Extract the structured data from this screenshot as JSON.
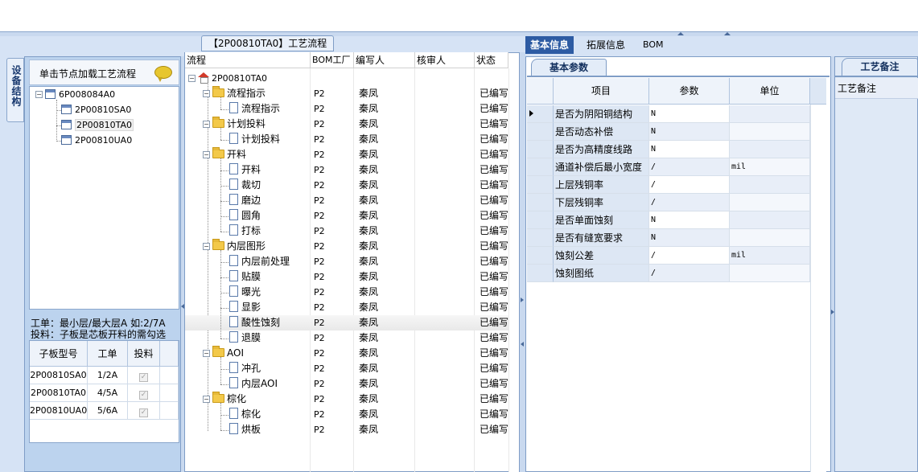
{
  "left": {
    "vertical_tab": "设备结构",
    "header_text": "单击节点加载工艺流程",
    "tree": [
      {
        "label": "6P008084A0",
        "level": 0
      },
      {
        "label": "2P00810SA0",
        "level": 1
      },
      {
        "label": "2P00810TA0",
        "level": 1,
        "selected": true
      },
      {
        "label": "2P00810UA0",
        "level": 1
      }
    ],
    "hint_line1": "工单：最小层/最大层A 如:2/7A",
    "hint_line2": "投料：子板是芯板开料的需勾选",
    "sub_grid": {
      "headers": [
        "子板型号",
        "工单",
        "投料"
      ],
      "rows": [
        {
          "model": "2P00810SA0",
          "order": "1/2A",
          "feed": true
        },
        {
          "model": "2P00810TA0",
          "order": "4/5A",
          "feed": true
        },
        {
          "model": "2P00810UA0",
          "order": "5/6A",
          "feed": true
        }
      ]
    }
  },
  "middle": {
    "title": "【2P00810TA0】工艺流程",
    "headers": [
      "流程",
      "BOM工厂",
      "编写人",
      "核审人",
      "状态"
    ],
    "root": "2P00810TA0",
    "rows": [
      {
        "name": "流程指示",
        "type": "folder",
        "bom": "P2",
        "author": "秦凤",
        "status": "已编写"
      },
      {
        "name": "流程指示",
        "type": "doc",
        "bom": "P2",
        "author": "秦凤",
        "status": "已编写"
      },
      {
        "name": "计划投料",
        "type": "folder",
        "bom": "P2",
        "author": "秦凤",
        "status": "已编写"
      },
      {
        "name": "计划投料",
        "type": "doc",
        "bom": "P2",
        "author": "秦凤",
        "status": "已编写"
      },
      {
        "name": "开料",
        "type": "folder",
        "bom": "P2",
        "author": "秦凤",
        "status": "已编写"
      },
      {
        "name": "开料",
        "type": "doc",
        "bom": "P2",
        "author": "秦凤",
        "status": "已编写"
      },
      {
        "name": "裁切",
        "type": "doc",
        "bom": "P2",
        "author": "秦凤",
        "status": "已编写"
      },
      {
        "name": "磨边",
        "type": "doc",
        "bom": "P2",
        "author": "秦凤",
        "status": "已编写"
      },
      {
        "name": "圆角",
        "type": "doc",
        "bom": "P2",
        "author": "秦凤",
        "status": "已编写"
      },
      {
        "name": "打标",
        "type": "doc",
        "bom": "P2",
        "author": "秦凤",
        "status": "已编写"
      },
      {
        "name": "内层图形",
        "type": "folder",
        "bom": "P2",
        "author": "秦凤",
        "status": "已编写"
      },
      {
        "name": "内层前处理",
        "type": "doc",
        "bom": "P2",
        "author": "秦凤",
        "status": "已编写"
      },
      {
        "name": "贴膜",
        "type": "doc",
        "bom": "P2",
        "author": "秦凤",
        "status": "已编写"
      },
      {
        "name": "曝光",
        "type": "doc",
        "bom": "P2",
        "author": "秦凤",
        "status": "已编写"
      },
      {
        "name": "显影",
        "type": "doc",
        "bom": "P2",
        "author": "秦凤",
        "status": "已编写"
      },
      {
        "name": "酸性蚀刻",
        "type": "doc",
        "bom": "P2",
        "author": "秦凤",
        "status": "已编写",
        "selected": true
      },
      {
        "name": "退膜",
        "type": "doc",
        "bom": "P2",
        "author": "秦凤",
        "status": "已编写"
      },
      {
        "name": "AOI",
        "type": "folder",
        "bom": "P2",
        "author": "秦凤",
        "status": "已编写"
      },
      {
        "name": "冲孔",
        "type": "doc",
        "bom": "P2",
        "author": "秦凤",
        "status": "已编写"
      },
      {
        "name": "内层AOI",
        "type": "doc",
        "bom": "P2",
        "author": "秦凤",
        "status": "已编写"
      },
      {
        "name": "棕化",
        "type": "folder",
        "bom": "P2",
        "author": "秦凤",
        "status": "已编写"
      },
      {
        "name": "棕化",
        "type": "doc",
        "bom": "P2",
        "author": "秦凤",
        "status": "已编写"
      },
      {
        "name": "烘板",
        "type": "doc",
        "bom": "P2",
        "author": "秦凤",
        "status": "已编写"
      }
    ]
  },
  "right": {
    "tabs": [
      "基本信息",
      "拓展信息",
      "BOM"
    ],
    "subtab": "基本参数",
    "headers": [
      "项目",
      "参数",
      "单位"
    ],
    "params": [
      {
        "name": "是否为阴阳铜结构",
        "value": "N",
        "unit": ""
      },
      {
        "name": "是否动态补偿",
        "value": "N",
        "unit": ""
      },
      {
        "name": "是否为高精度线路",
        "value": "N",
        "unit": ""
      },
      {
        "name": "通道补偿后最小宽度",
        "value": "/",
        "unit": "mil"
      },
      {
        "name": "上层残铜率",
        "value": "/",
        "unit": ""
      },
      {
        "name": "下层残铜率",
        "value": "/",
        "unit": ""
      },
      {
        "name": "是否单面蚀刻",
        "value": "N",
        "unit": ""
      },
      {
        "name": "是否有缝宽要求",
        "value": "N",
        "unit": ""
      },
      {
        "name": "蚀刻公差",
        "value": "/",
        "unit": "mil"
      },
      {
        "name": "蚀刻图纸",
        "value": "/",
        "unit": ""
      }
    ]
  },
  "notes": {
    "tab": "工艺备注",
    "label": "工艺备注"
  },
  "colors": {
    "panel_bg": "#d6e3f5",
    "active_tab": "#2d5ba3",
    "border": "#7f9dc6"
  }
}
